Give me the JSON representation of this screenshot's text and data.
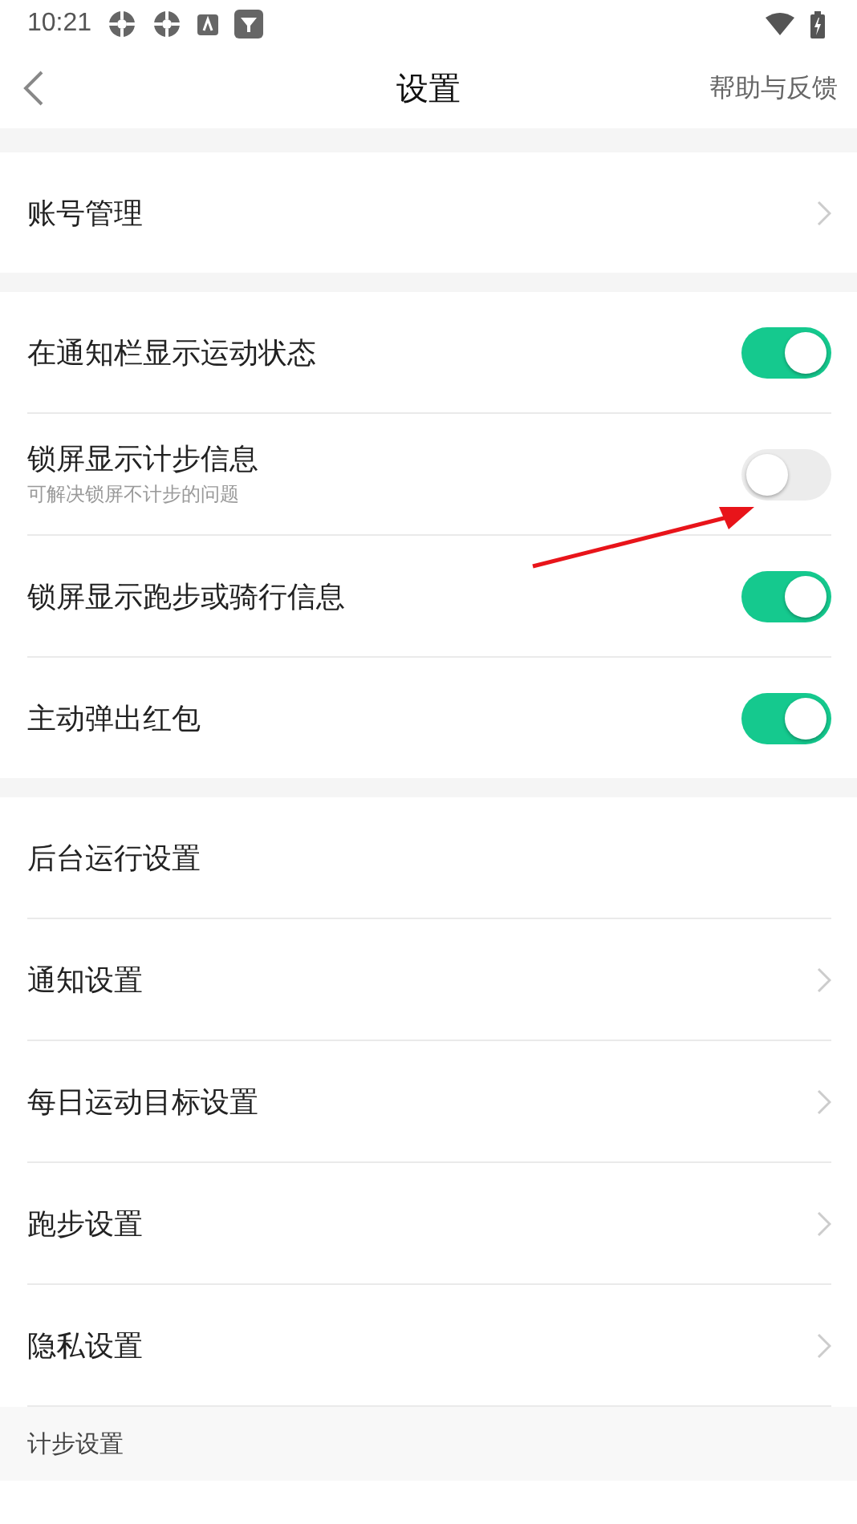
{
  "status_bar": {
    "time": "10:21"
  },
  "header": {
    "title": "设置",
    "action": "帮助与反馈"
  },
  "groups": [
    {
      "items": [
        {
          "kind": "link",
          "label": "账号管理"
        }
      ]
    },
    {
      "items": [
        {
          "kind": "toggle",
          "label": "在通知栏显示运动状态",
          "on": true
        },
        {
          "kind": "toggle",
          "label": "锁屏显示计步信息",
          "subtitle": "可解决锁屏不计步的问题",
          "on": false
        },
        {
          "kind": "toggle",
          "label": "锁屏显示跑步或骑行信息",
          "on": true
        },
        {
          "kind": "toggle",
          "label": "主动弹出红包",
          "on": true
        }
      ]
    },
    {
      "items": [
        {
          "kind": "plain",
          "label": "后台运行设置"
        },
        {
          "kind": "link",
          "label": "通知设置"
        },
        {
          "kind": "link",
          "label": "每日运动目标设置"
        },
        {
          "kind": "link",
          "label": "跑步设置"
        },
        {
          "kind": "link",
          "label": "隐私设置"
        }
      ]
    }
  ],
  "section_header": "计步设置"
}
